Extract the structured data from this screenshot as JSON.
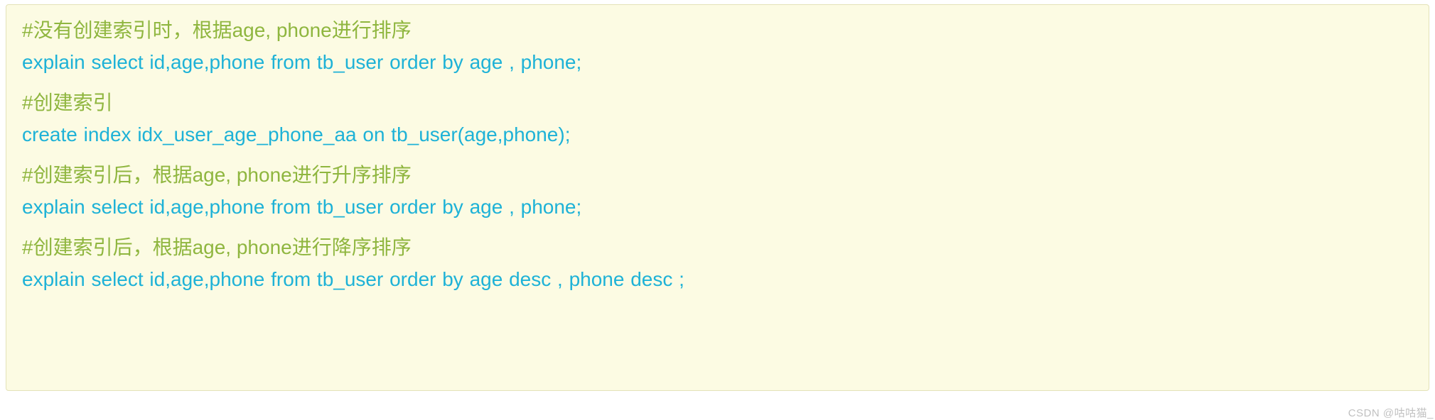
{
  "code": {
    "blocks": [
      {
        "comment": "#没有创建索引时，根据age, phone进行排序",
        "sql": "explain select  id,age,phone from tb_user order by age , phone;"
      },
      {
        "comment": "#创建索引",
        "sql": "create  index  idx_user_age_phone_aa  on  tb_user(age,phone);"
      },
      {
        "comment": "#创建索引后，根据age, phone进行升序排序",
        "sql": "explain select  id,age,phone from tb_user order by age , phone;"
      },
      {
        "comment": "#创建索引后，根据age, phone进行降序排序",
        "sql": "explain select  id,age,phone from tb_user order by age desc , phone desc ;"
      }
    ]
  },
  "watermark": "CSDN @咕咕猫_"
}
